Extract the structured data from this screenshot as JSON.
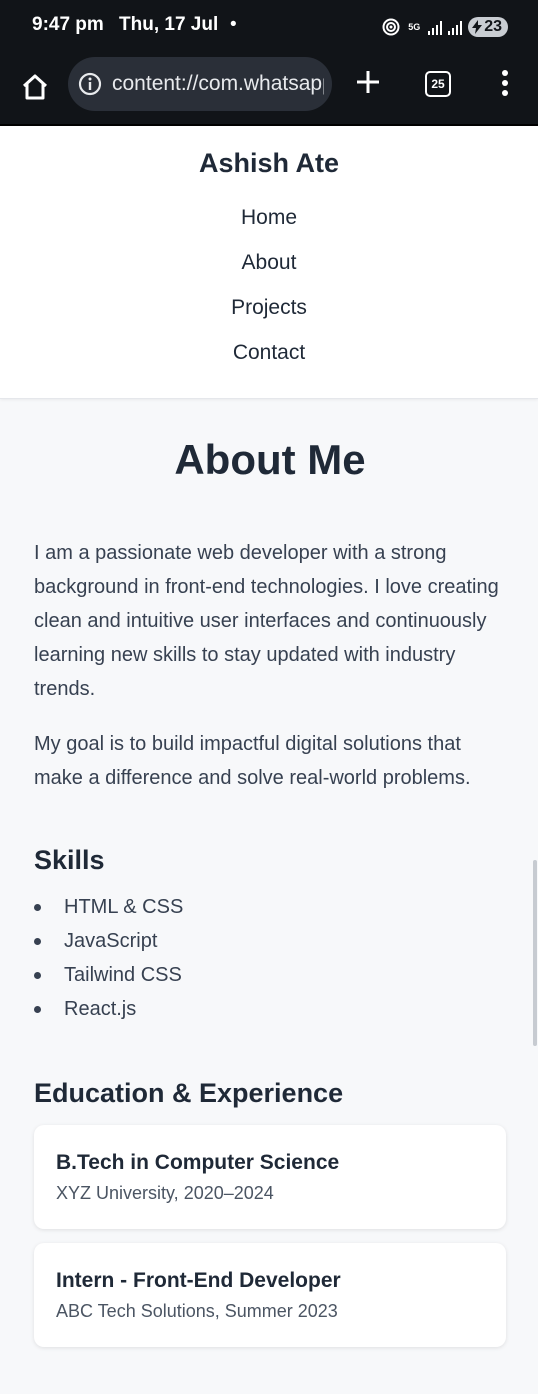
{
  "status_bar": {
    "time": "9:47 pm",
    "date": "Thu, 17 Jul",
    "dot": "•",
    "network": "5G",
    "battery": "23"
  },
  "browser": {
    "url": "content://com.whatsapp",
    "tab_count": "25"
  },
  "site": {
    "title": "Ashish Ate",
    "nav": [
      "Home",
      "About",
      "Projects",
      "Contact"
    ]
  },
  "about": {
    "title": "About Me",
    "paragraphs": [
      "I am a passionate web developer with a strong background in front-end technologies. I love creating clean and intuitive user interfaces and continuously learning new skills to stay updated with industry trends.",
      "My goal is to build impactful digital solutions that make a difference and solve real-world problems."
    ]
  },
  "skills": {
    "heading": "Skills",
    "items": [
      "HTML & CSS",
      "JavaScript",
      "Tailwind CSS",
      "React.js"
    ]
  },
  "education": {
    "heading": "Education & Experience",
    "cards": [
      {
        "title": "B.Tech in Computer Science",
        "subtitle": "XYZ University, 2020–2024"
      },
      {
        "title": "Intern - Front-End Developer",
        "subtitle": "ABC Tech Solutions, Summer 2023"
      }
    ]
  },
  "colors": {
    "status_bar_bg": "#111418",
    "page_bg": "#f7f8fa",
    "text_primary": "#1f2937",
    "text_body": "#374151"
  }
}
